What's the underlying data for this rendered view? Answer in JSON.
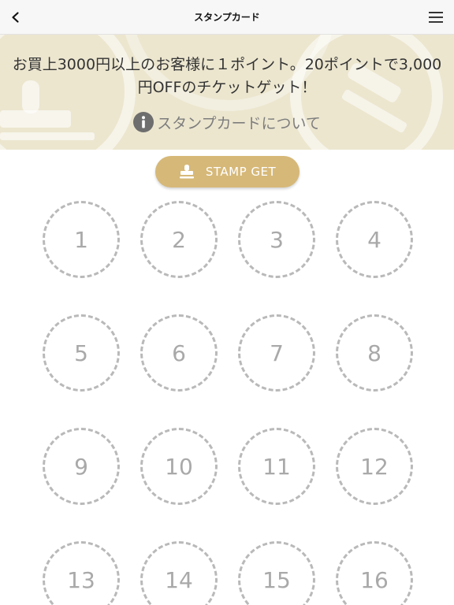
{
  "nav": {
    "title": "スタンプカード",
    "back_icon": "chevron-left-icon",
    "menu_icon": "hamburger-menu-icon"
  },
  "banner": {
    "message": "お買上3000円以上のお客様に１ポイント。20ポイントで3,000円OFFのチケットゲット！",
    "info_label": "スタンプカードについて",
    "info_icon": "info-icon",
    "background_color": "#ece6cf"
  },
  "stamp_button": {
    "label": "STAMP GET",
    "icon": "stamp-icon",
    "color": "#d6b878"
  },
  "stamps": [
    {
      "number": "1"
    },
    {
      "number": "2"
    },
    {
      "number": "3"
    },
    {
      "number": "4"
    },
    {
      "number": "5"
    },
    {
      "number": "6"
    },
    {
      "number": "7"
    },
    {
      "number": "8"
    },
    {
      "number": "9"
    },
    {
      "number": "10"
    },
    {
      "number": "11"
    },
    {
      "number": "12"
    },
    {
      "number": "13"
    },
    {
      "number": "14"
    },
    {
      "number": "15"
    },
    {
      "number": "16"
    }
  ]
}
